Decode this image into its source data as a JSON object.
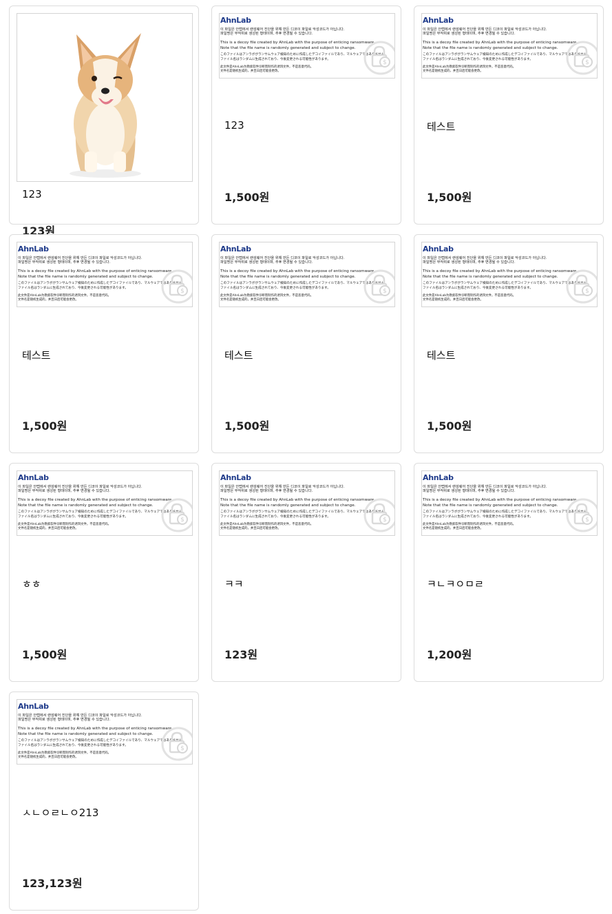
{
  "decoy": {
    "brand": "AhnLab",
    "line1": "이 파일은 안랩에서 랜섬웨어 진단을 위해 만든 디코이 파일로 악성코드가 아닙니다.",
    "line2": "파일명은 무작위로 생성된 형태이며, 추후 변경될 수 있습니다.",
    "line3": "This is a decoy file created by AhnLab with the purpose of enticing ransomware.",
    "line4": "Note that the file name is randomly generated and subject to change.",
    "line5": "このファイルはアンラボがランサムウェア検知のために作成したデコイファイルであり、マルウェアではありません。",
    "line6": "ファイル名はランダムに生成されており、今後変更される可能性があります。",
    "line7": "此文件是AhnLab为勒索软件诊断而制作的诱饵文件，不是恶意代码。",
    "line8": "文件名是随机生成的，并且日后可能会更改。"
  },
  "products": [
    {
      "name": "123",
      "price": "123원",
      "image": "corgi-photo"
    },
    {
      "name": "123",
      "price": "1,500원",
      "image": "decoy"
    },
    {
      "name": "테스트",
      "price": "1,500원",
      "image": "decoy"
    },
    {
      "name": "테스트",
      "price": "1,500원",
      "image": "decoy"
    },
    {
      "name": "테스트",
      "price": "1,500원",
      "image": "decoy"
    },
    {
      "name": "테스트",
      "price": "1,500원",
      "image": "decoy"
    },
    {
      "name": "ㅎㅎ",
      "price": "1,500원",
      "image": "decoy"
    },
    {
      "name": "ㅋㅋ",
      "price": "123원",
      "image": "decoy"
    },
    {
      "name": "ㅋㄴㅋㅇㅁㄹ",
      "price": "1,200원",
      "image": "decoy"
    },
    {
      "name": "ㅅㄴㅇㄹㄴㅇ213",
      "price": "123,123원",
      "image": "decoy"
    }
  ]
}
